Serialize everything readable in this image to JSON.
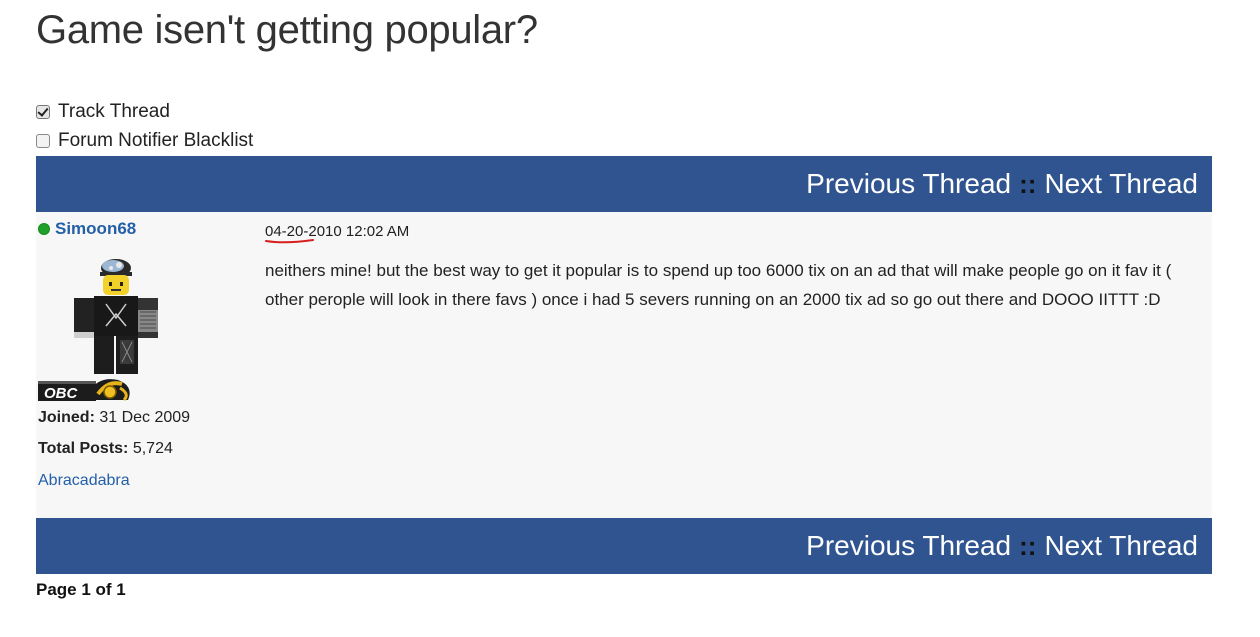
{
  "thread": {
    "title": "Game isen't getting popular?"
  },
  "options": {
    "track_thread": {
      "label": "Track Thread",
      "checked": true
    },
    "forum_notifier_blacklist": {
      "label": "Forum Notifier Blacklist",
      "checked": false
    }
  },
  "navigation": {
    "previous_label": "Previous Thread",
    "separator": "::",
    "next_label": "Next Thread"
  },
  "post": {
    "author": {
      "username": "Simoon68",
      "online": true,
      "badge_text": "OBC",
      "joined_label": "Joined:",
      "joined_value": "31 Dec 2009",
      "total_posts_label": "Total Posts:",
      "total_posts_value": "5,724",
      "signature_link": "Abracadabra"
    },
    "date": "04-20-2010 12:02 AM",
    "body": "neithers mine! but the best way to get it popular is to spend up too 6000 tix on an ad that will make people go on it fav it ( other perople will look in there favs ) once i had 5 severs running on an 2000 tix ad so go out there and DOOO IITTT :D"
  },
  "pagination": {
    "text": "Page 1 of 1"
  },
  "colors": {
    "nav_bar": "#2f5490",
    "post_background": "#f7f7f7",
    "link": "#2460a7",
    "online": "#1fa12a",
    "annotation_underline": "#d62020"
  },
  "icons": {
    "online_status": "online-dot-icon",
    "avatar": "avatar-image",
    "badge": "obc-badge-icon"
  }
}
